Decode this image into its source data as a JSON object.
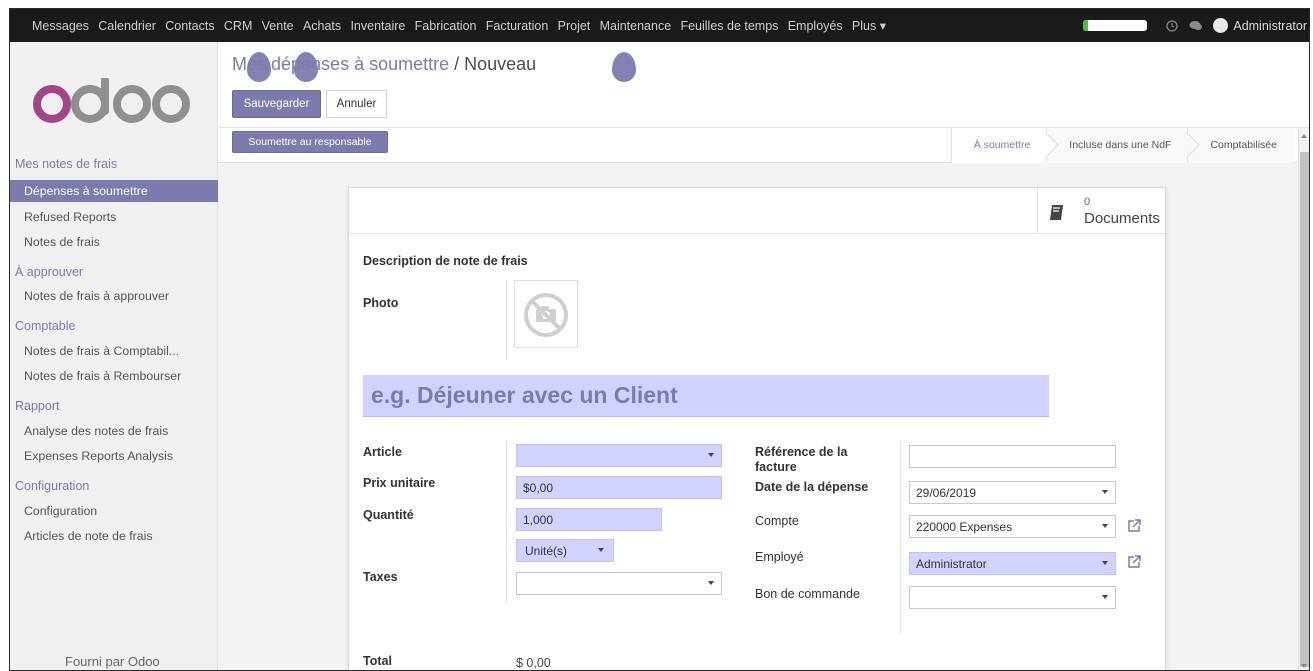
{
  "topbar": {
    "menu": [
      "Messages",
      "Calendrier",
      "Contacts",
      "CRM",
      "Vente",
      "Achats",
      "Inventaire",
      "Fabrication",
      "Facturation",
      "Projet",
      "Maintenance",
      "Feuilles de temps",
      "Employés",
      "Plus ▾"
    ],
    "user": "Administrator",
    "progress_fraction": 0.08,
    "icons": [
      "clock-icon",
      "chat-icon"
    ]
  },
  "sidebar": {
    "logo": "odoo",
    "sections": [
      {
        "title": "Mes notes de frais",
        "items": [
          "Dépenses à soumettre",
          "Refused Reports",
          "Notes de frais"
        ]
      },
      {
        "title": "À approuver",
        "items": [
          "Notes de frais à approuver"
        ]
      },
      {
        "title": "Comptable",
        "items": [
          "Notes de frais à Comptabil...",
          "Notes de frais à Rembourser"
        ]
      },
      {
        "title": "Rapport",
        "items": [
          "Analyse des notes de frais",
          "Expenses Reports Analysis"
        ]
      },
      {
        "title": "Configuration",
        "items": [
          "Configuration",
          "Articles de note de frais"
        ]
      }
    ],
    "active_item": "Dépenses à soumettre",
    "powered_by": "Fourni par Odoo"
  },
  "control_panel": {
    "breadcrumb_parent": "Mes dépenses à soumettre",
    "breadcrumb_sep": " / ",
    "breadcrumb_current": "Nouveau",
    "save_label": "Sauvegarder",
    "cancel_label": "Annuler"
  },
  "statusbar": {
    "submit_label": "Soumettre au responsable",
    "stages": [
      "À soumettre",
      "Incluse dans une NdF",
      "Comptabilisée"
    ],
    "current_stage": "À soumettre"
  },
  "sheet": {
    "documents": {
      "count": "0",
      "label": "Documents"
    },
    "description_label": "Description de note de frais",
    "photo_label": "Photo",
    "name_placeholder": "e.g. Déjeuner avec un Client",
    "left_fields": {
      "article_label": "Article",
      "article_value": "",
      "unit_price_label": "Prix unitaire",
      "unit_price_value": "$0,00",
      "quantity_label": "Quantité",
      "quantity_value": "1,000",
      "uom_value": "Unité(s)",
      "taxes_label": "Taxes",
      "taxes_value": ""
    },
    "right_fields": {
      "invoice_ref_label": "Référence de la facture",
      "invoice_ref_value": "",
      "date_label": "Date de la dépense",
      "date_value": "29/06/2019",
      "account_label": "Compte",
      "account_value": "220000 Expenses",
      "employee_label": "Employé",
      "employee_value": "Administrator",
      "po_label": "Bon de commande",
      "po_value": ""
    },
    "total_label": "Total",
    "total_value": "$ 0,00"
  },
  "colors": {
    "brand": "#7c7bad",
    "required_field": "#d2d2ff",
    "topbar": "#1a1a1a"
  }
}
